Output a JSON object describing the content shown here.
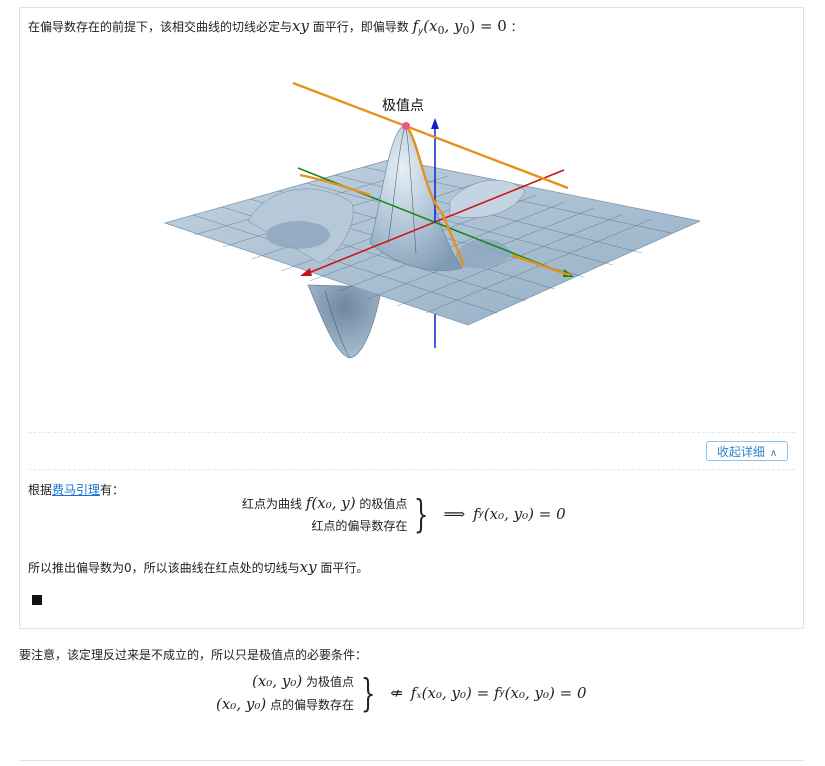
{
  "card": {
    "intro_text": "在偏导数存在的前提下，该相交曲线的切线必定与",
    "intro_xy": "xy",
    "intro_text2": " 面平行，即偏导数 ",
    "intro_f": "f",
    "intro_sub": "y",
    "intro_args": "(x",
    "intro_arg0": "0",
    "intro_comma": ", y",
    "intro_arg1": "0",
    "intro_close": ") = 0",
    "intro_colon": " ：",
    "figure": {
      "label": "极值点"
    },
    "collapse_label": "收起详细",
    "fermat_prefix": "根据",
    "fermat_link": "费马引理",
    "fermat_suffix": "有：",
    "sys1": {
      "row1_pre": "红点为曲线 ",
      "row1_math": "f(x₀, y)",
      "row1_post": " 的极值点",
      "row2": "红点的偏导数存在",
      "rhs": "f",
      "rhs_sub": "y",
      "rhs_rest": "(x₀, y₀) = 0"
    },
    "conclusion_text": "所以推出偏导数为0，所以该曲线在红点处的切线与",
    "conclusion_xy": "xy",
    "conclusion_text2": " 面平行。"
  },
  "note_text": "要注意，该定理反过来是不成立的，所以只是极值点的必要条件：",
  "sys2": {
    "row1_math": "(x₀, y₀)",
    "row1_post": " 为极值点",
    "row2_math": "(x₀, y₀)",
    "row2_post": " 点的偏导数存在",
    "rhs": "fₓ(x₀, y₀) = f",
    "rhs_sub": "y",
    "rhs_rest": "(x₀, y₀) = 0"
  },
  "colors": {
    "surface": "#a9bfd2",
    "orange": "#e8911a",
    "red_axis": "#cc1111",
    "green_axis": "#118811",
    "blue_axis": "#1122cc",
    "link": "#1a6fd6",
    "button_border": "#8fc2e6"
  }
}
